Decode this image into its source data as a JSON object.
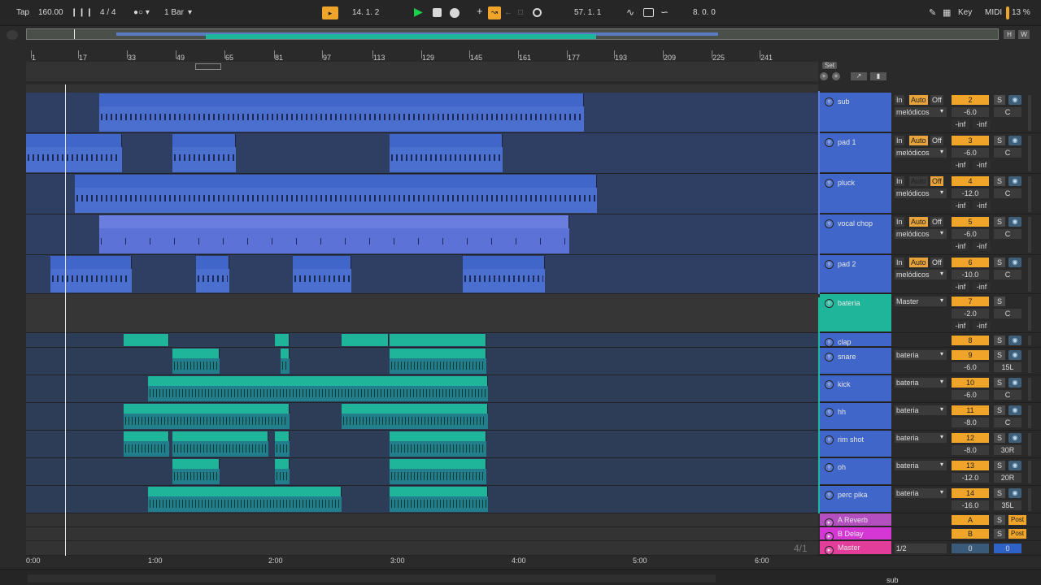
{
  "toolbar": {
    "tap": "Tap",
    "tempo": "160.00",
    "signature": "4 / 4",
    "quantize": "1 Bar",
    "position": "14.  1.  2",
    "loop_start": "57.  1.  1",
    "loop_length": "8.  0.  0",
    "key": "Key",
    "midi": "MIDI",
    "cpu": "13 %"
  },
  "overview": {
    "h": "H",
    "w": "W"
  },
  "ruler": [
    "1",
    "17",
    "33",
    "49",
    "65",
    "81",
    "97",
    "113",
    "129",
    "145",
    "161",
    "177",
    "193",
    "209",
    "225",
    "241"
  ],
  "time_ruler": [
    "0:00",
    "1:00",
    "2:00",
    "3:00",
    "4:00",
    "5:00",
    "6:00"
  ],
  "overlay_text": "4/1",
  "set_label": "Set",
  "tracks": [
    {
      "name": "sub",
      "num": "2",
      "vol": "-6.0",
      "pan": "C",
      "in": "In",
      "auto": "Auto",
      "off": "Off",
      "route": "melódicos",
      "send1": "-inf",
      "send2": "-inf"
    },
    {
      "name": "pad 1",
      "num": "3",
      "vol": "-6.0",
      "pan": "C",
      "in": "In",
      "auto": "Auto",
      "off": "Off",
      "route": "melódicos",
      "send1": "-inf",
      "send2": "-inf"
    },
    {
      "name": "pluck",
      "num": "4",
      "vol": "-12.0",
      "pan": "C",
      "in": "In",
      "auto": "Auto",
      "off": "Off",
      "route": "melódicos",
      "send1": "-inf",
      "send2": "-inf"
    },
    {
      "name": "vocal chop",
      "num": "5",
      "vol": "-6.0",
      "pan": "C",
      "in": "In",
      "auto": "Auto",
      "off": "Off",
      "route": "melódicos",
      "send1": "-inf",
      "send2": "-inf"
    },
    {
      "name": "pad 2",
      "num": "6",
      "vol": "-10.0",
      "pan": "C",
      "in": "In",
      "auto": "Auto",
      "off": "Off",
      "route": "melódicos",
      "send1": "-inf",
      "send2": "-inf"
    },
    {
      "name": "bateria",
      "num": "7",
      "vol": "-2.0",
      "pan": "C",
      "route": "Master",
      "send1": "-inf",
      "send2": "-inf"
    },
    {
      "name": "clap",
      "num": "8"
    },
    {
      "name": "snare",
      "num": "9",
      "vol": "-6.0",
      "pan": "15L",
      "route": "bateria"
    },
    {
      "name": "kick",
      "num": "10",
      "vol": "-6.0",
      "pan": "C",
      "route": "bateria"
    },
    {
      "name": "hh",
      "num": "11",
      "vol": "-8.0",
      "pan": "C",
      "route": "bateria"
    },
    {
      "name": "rim shot",
      "num": "12",
      "vol": "-8.0",
      "pan": "30R",
      "route": "bateria"
    },
    {
      "name": "oh",
      "num": "13",
      "vol": "-12.0",
      "pan": "20R",
      "route": "bateria"
    },
    {
      "name": "perc pika",
      "num": "14",
      "vol": "-16.0",
      "pan": "35L",
      "route": "bateria"
    }
  ],
  "returns": [
    {
      "name": "A Reverb",
      "letter": "A",
      "post": "Post"
    },
    {
      "name": "B Delay",
      "letter": "B",
      "post": "Post"
    }
  ],
  "master": {
    "name": "Master",
    "route": "1/2",
    "vol": "0",
    "pan": "0"
  },
  "bottom": {
    "clip_name": "sub"
  }
}
